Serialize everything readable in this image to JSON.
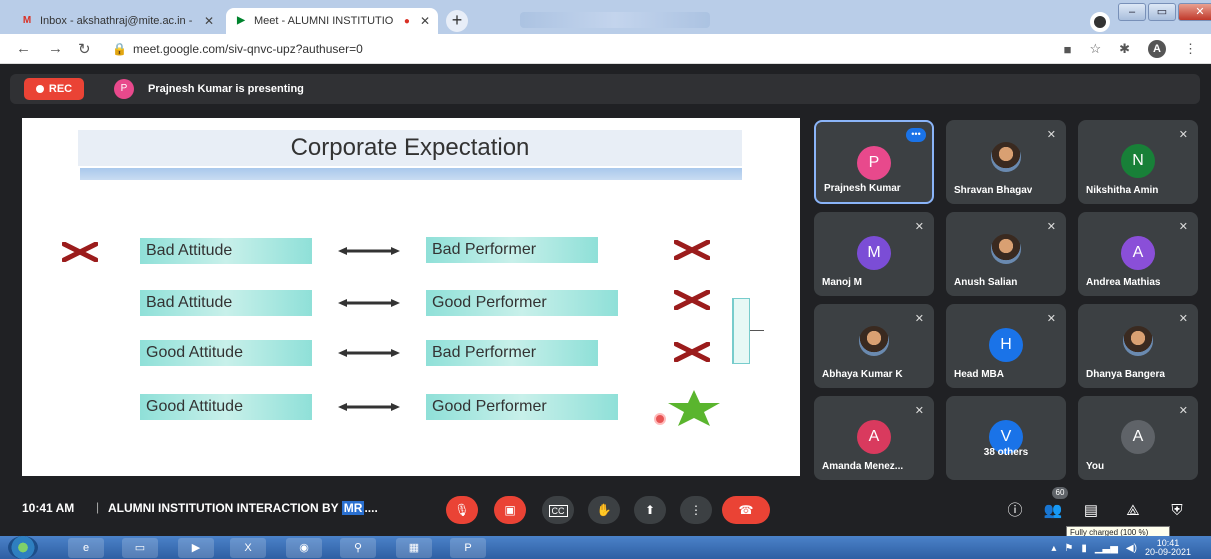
{
  "browser": {
    "tabs": [
      {
        "label": "Inbox - akshathraj@mite.ac.in - ",
        "icon": "gmail-icon"
      },
      {
        "label": "Meet - ALUMNI INSTITUTIO",
        "icon": "meet-icon"
      }
    ],
    "new_tab": "+",
    "url": "meet.google.com/siv-qnvc-upz?authuser=0",
    "profile_initial": "A"
  },
  "meet": {
    "rec_label": "REC",
    "presenter_initial": "P",
    "presenting_text": "Prajnesh Kumar is presenting",
    "slide": {
      "title": "Corporate Expectation",
      "rows": [
        {
          "attitude": "Bad Attitude",
          "performance": "Bad Performer",
          "left_mark": "cross",
          "right_mark": "cross"
        },
        {
          "attitude": "Bad Attitude",
          "performance": "Good Performer",
          "right_mark": "cross"
        },
        {
          "attitude": "Good Attitude",
          "performance": "Bad Performer",
          "right_mark": "cross"
        },
        {
          "attitude": "Good Attitude",
          "performance": "Good Performer",
          "right_mark": "star"
        }
      ]
    },
    "participants": [
      {
        "name": "Prajnesh Kumar",
        "initial": "P",
        "color": "#e8498c",
        "active": true
      },
      {
        "name": "Shravan Bhagav",
        "photo": true
      },
      {
        "name": "Nikshitha Amin",
        "initial": "N",
        "color": "#188038"
      },
      {
        "name": "Manoj M",
        "initial": "M",
        "color": "#7b4dd6"
      },
      {
        "name": "Anush Salian",
        "photo": true
      },
      {
        "name": "Andrea Mathias",
        "initial": "A",
        "color": "#8a4fd8"
      },
      {
        "name": "Abhaya Kumar K",
        "photo": true
      },
      {
        "name": "Head MBA",
        "initial": "H",
        "color": "#1a73e8"
      },
      {
        "name": "Dhanya Bangera",
        "photo": true
      },
      {
        "name": "Amanda Menez...",
        "initial": "A",
        "color": "#d93a5e"
      },
      {
        "name": "38 others",
        "initial": "V",
        "color": "#1a73e8"
      },
      {
        "name": "You",
        "initial": "A",
        "color": "#5f6368"
      }
    ],
    "more_icon": "•••",
    "bottom": {
      "time": "10:41 AM",
      "separator": "|",
      "meeting_title": "ALUMNI INSTITUTION INTERACTION BY ",
      "meeting_title_hl": "MR",
      "meeting_title_tail": "....",
      "people_count": "60",
      "tooltip": "Fully charged (100 %)"
    }
  },
  "taskbar": {
    "clock_time": "10:41",
    "clock_date": "20-09-2021"
  },
  "colors": {
    "meet_bg": "#202124",
    "tile_bg": "#3c4043",
    "red": "#ea4335",
    "pill": "#8fe0d8"
  }
}
